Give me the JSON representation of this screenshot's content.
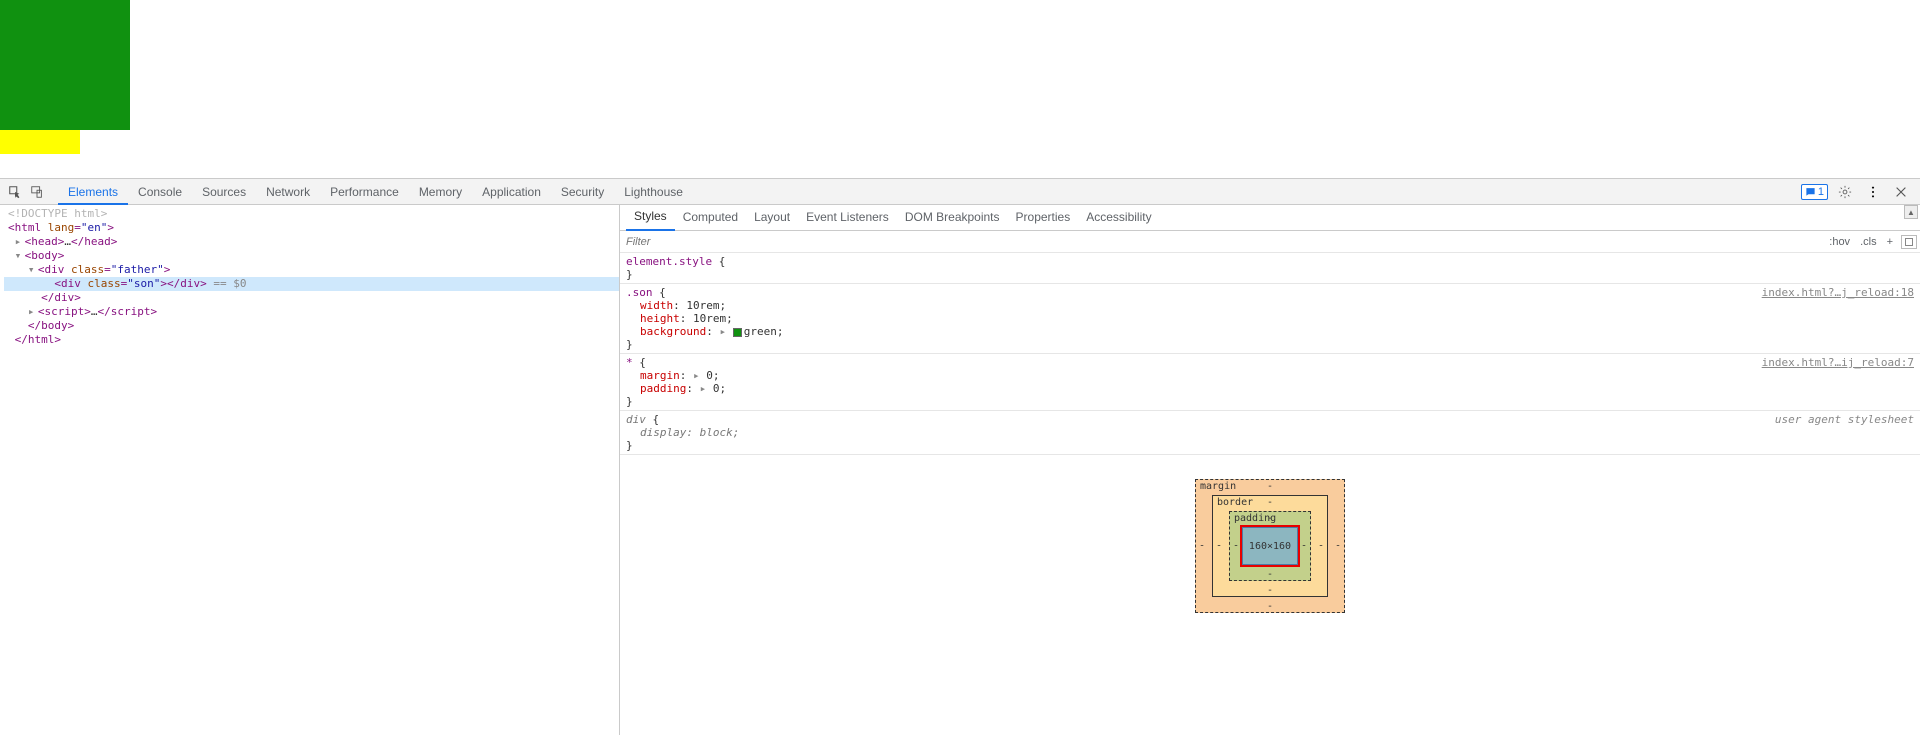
{
  "devtools": {
    "tabs": [
      "Elements",
      "Console",
      "Sources",
      "Network",
      "Performance",
      "Memory",
      "Application",
      "Security",
      "Lighthouse"
    ],
    "active_tab": "Elements",
    "issues_badge": "1"
  },
  "dom": {
    "doctype": "<!DOCTYPE html>",
    "html_open": "<html lang=\"en\">",
    "head": "<head>…</head>",
    "body_open": "<body>",
    "father_open": "<div class=\"father\">",
    "son": "<div class=\"son\"></div>",
    "eq0": " == $0",
    "father_close": "</div>",
    "script": "<script>…</script>",
    "body_close": "</body>",
    "html_close": "</html>"
  },
  "styles": {
    "sub_tabs": [
      "Styles",
      "Computed",
      "Layout",
      "Event Listeners",
      "DOM Breakpoints",
      "Properties",
      "Accessibility"
    ],
    "active_sub_tab": "Styles",
    "filter_placeholder": "Filter",
    "hov": ":hov",
    "cls": ".cls",
    "rules": [
      {
        "selector": "element.style",
        "brace_open": " {",
        "decls": [],
        "brace_close": "}",
        "link": ""
      },
      {
        "selector": ".son",
        "brace_open": " {",
        "decls": [
          {
            "prop": "width",
            "val": "10rem;"
          },
          {
            "prop": "height",
            "val": "10rem;"
          },
          {
            "prop": "background",
            "tri": "▸",
            "swatch": true,
            "val": "green;"
          }
        ],
        "brace_close": "}",
        "link": "index.html?…j_reload:18"
      },
      {
        "selector": "*",
        "brace_open": " {",
        "decls": [
          {
            "prop": "margin",
            "tri": "▸",
            "val": "0;"
          },
          {
            "prop": "padding",
            "tri": "▸",
            "val": "0;"
          }
        ],
        "brace_close": "}",
        "link": "index.html?…ij_reload:7"
      },
      {
        "selector": "div",
        "brace_open": " {",
        "italic": true,
        "decls": [
          {
            "prop": "display",
            "val": "block;",
            "italic": true
          }
        ],
        "brace_close": "}",
        "ua": "user agent stylesheet"
      }
    ]
  },
  "boxmodel": {
    "margin_label": "margin",
    "border_label": "border",
    "padding_label": "padding",
    "content": "160×160",
    "dash": "-"
  }
}
